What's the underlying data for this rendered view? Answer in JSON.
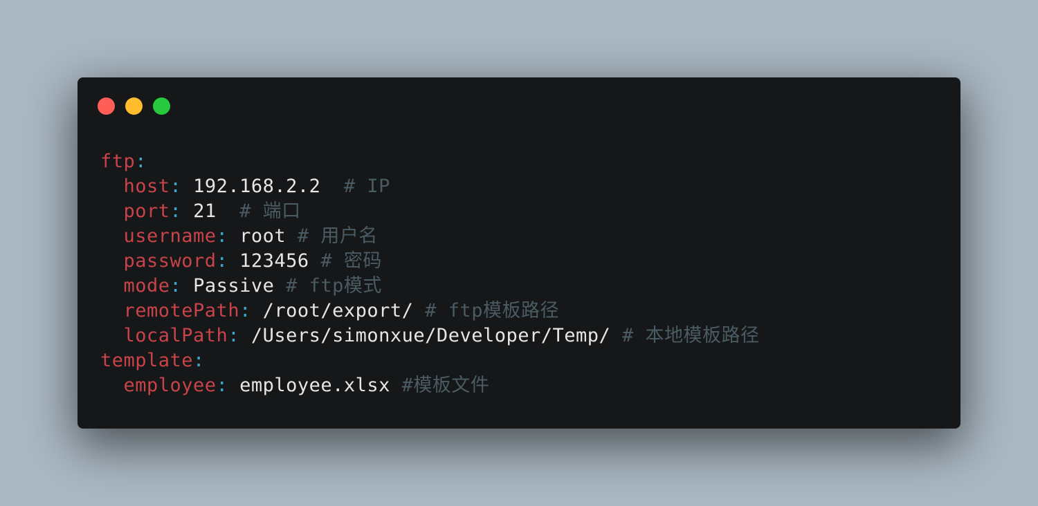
{
  "window": {
    "controls": [
      {
        "name": "close",
        "color": "#ff5f56"
      },
      {
        "name": "minimize",
        "color": "#ffbd2e"
      },
      {
        "name": "zoom",
        "color": "#27c93f"
      }
    ]
  },
  "colors": {
    "background": "#abb8c3",
    "editor_bg": "#151718",
    "key": "#c8434a",
    "colon": "#3ca7c9",
    "value": "#e6e6e6",
    "comment": "#4a5b63"
  },
  "code": {
    "lines": [
      {
        "indent": "",
        "key": "ftp",
        "colon": ":",
        "value": "",
        "comment": ""
      },
      {
        "indent": "  ",
        "key": "host",
        "colon": ":",
        "value": " 192.168.2.2",
        "comment": "  # IP"
      },
      {
        "indent": "  ",
        "key": "port",
        "colon": ":",
        "value": " 21",
        "comment": "  # 端口"
      },
      {
        "indent": "  ",
        "key": "username",
        "colon": ":",
        "value": " root",
        "comment": " # 用户名"
      },
      {
        "indent": "  ",
        "key": "password",
        "colon": ":",
        "value": " 123456",
        "comment": " # 密码"
      },
      {
        "indent": "  ",
        "key": "mode",
        "colon": ":",
        "value": " Passive",
        "comment": " # ftp模式"
      },
      {
        "indent": "  ",
        "key": "remotePath",
        "colon": ":",
        "value": " /root/export/",
        "comment": " # ftp模板路径"
      },
      {
        "indent": "  ",
        "key": "localPath",
        "colon": ":",
        "value": " /Users/simonxue/Developer/Temp/",
        "comment": " # 本地模板路径"
      },
      {
        "indent": "",
        "key": "template",
        "colon": ":",
        "value": "",
        "comment": ""
      },
      {
        "indent": "  ",
        "key": "employee",
        "colon": ":",
        "value": " employee.xlsx",
        "comment": " #模板文件"
      }
    ]
  }
}
